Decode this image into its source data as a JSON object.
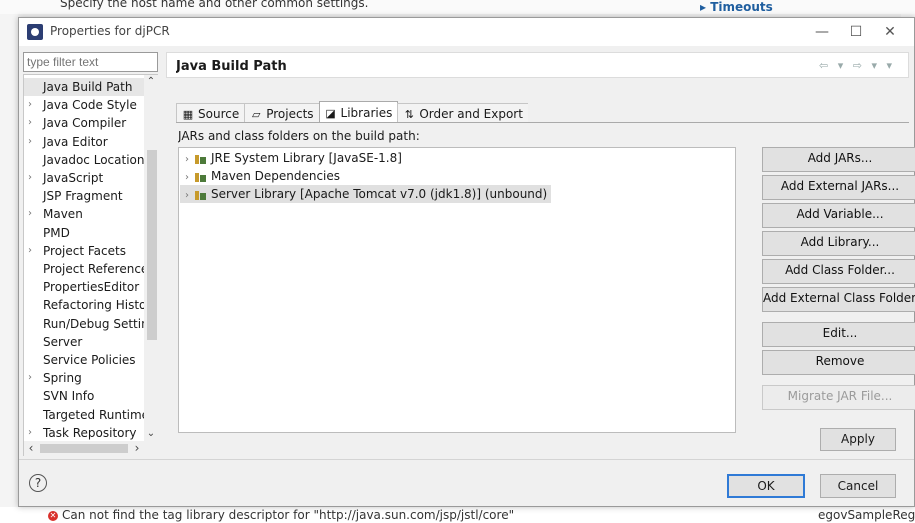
{
  "background": {
    "top_text": "Specify the host name and other common settings.",
    "timeouts_label": "▸ Timeouts",
    "error_text": "Can not find the tag library descriptor for \"http://java.sun.com/jsp/jstl/core\"",
    "right_bottom_text": "egovSampleRegis"
  },
  "dialog": {
    "title": "Properties for djPCR",
    "minimize": "—",
    "maximize": "☐",
    "close": "✕"
  },
  "filter": {
    "placeholder": "type filter text"
  },
  "tree": {
    "items": [
      {
        "label": "Java Build Path",
        "arrow": "",
        "selected": true
      },
      {
        "label": "Java Code Style",
        "arrow": "›"
      },
      {
        "label": "Java Compiler",
        "arrow": "›"
      },
      {
        "label": "Java Editor",
        "arrow": "›"
      },
      {
        "label": "Javadoc Location",
        "arrow": ""
      },
      {
        "label": "JavaScript",
        "arrow": "›"
      },
      {
        "label": "JSP Fragment",
        "arrow": ""
      },
      {
        "label": "Maven",
        "arrow": "›"
      },
      {
        "label": "PMD",
        "arrow": ""
      },
      {
        "label": "Project Facets",
        "arrow": "›"
      },
      {
        "label": "Project References",
        "arrow": ""
      },
      {
        "label": "PropertiesEditor",
        "arrow": ""
      },
      {
        "label": "Refactoring History",
        "arrow": ""
      },
      {
        "label": "Run/Debug Settings",
        "arrow": ""
      },
      {
        "label": "Server",
        "arrow": ""
      },
      {
        "label": "Service Policies",
        "arrow": ""
      },
      {
        "label": "Spring",
        "arrow": "›"
      },
      {
        "label": "SVN Info",
        "arrow": ""
      },
      {
        "label": "Targeted Runtimes",
        "arrow": ""
      },
      {
        "label": "Task Repository",
        "arrow": "›"
      }
    ],
    "scroll_up": "⌃",
    "scroll_down": "⌄",
    "scroll_left": "‹",
    "scroll_right": "›"
  },
  "pane": {
    "title": "Java Build Path",
    "nav_arrows": "⇦ ▾ ⇨ ▾ ▾",
    "tabs": [
      {
        "label": "Source",
        "icon": "source-folder-icon",
        "glyph": "▦",
        "active": false
      },
      {
        "label": "Projects",
        "icon": "projects-icon",
        "glyph": "▱",
        "active": false
      },
      {
        "label": "Libraries",
        "icon": "libraries-icon",
        "glyph": "◪",
        "active": true
      },
      {
        "label": "Order and Export",
        "icon": "order-export-icon",
        "glyph": "⇅",
        "active": false
      }
    ],
    "jars_label": "JARs and class folders on the build path:",
    "libraries": [
      {
        "label": "JRE System Library [JavaSE-1.8]",
        "selected": false
      },
      {
        "label": "Maven Dependencies",
        "selected": false
      },
      {
        "label": "Server Library [Apache Tomcat v7.0 (jdk1.8)] (unbound)",
        "selected": true
      }
    ],
    "library_arrow": "›",
    "buttons": [
      {
        "label": "Add JARs...",
        "name": "add-jars-button",
        "enabled": true
      },
      {
        "label": "Add External JARs...",
        "name": "add-external-jars-button",
        "enabled": true
      },
      {
        "label": "Add Variable...",
        "name": "add-variable-button",
        "enabled": true
      },
      {
        "label": "Add Library...",
        "name": "add-library-button",
        "enabled": true
      },
      {
        "label": "Add Class Folder...",
        "name": "add-class-folder-button",
        "enabled": true
      },
      {
        "label": "Add External Class Folder...",
        "name": "add-external-class-folder-button",
        "enabled": true
      },
      {
        "label": "Edit...",
        "name": "edit-button",
        "enabled": true
      },
      {
        "label": "Remove",
        "name": "remove-button",
        "enabled": true
      },
      {
        "label": "Migrate JAR File...",
        "name": "migrate-jar-file-button",
        "enabled": false
      }
    ]
  },
  "footer": {
    "apply": "Apply",
    "help": "?",
    "ok": "OK",
    "cancel": "Cancel"
  },
  "colors": {
    "ok_border": "#2f7ad6",
    "error_red": "#d9302b",
    "selection": "#e0e0e0"
  }
}
